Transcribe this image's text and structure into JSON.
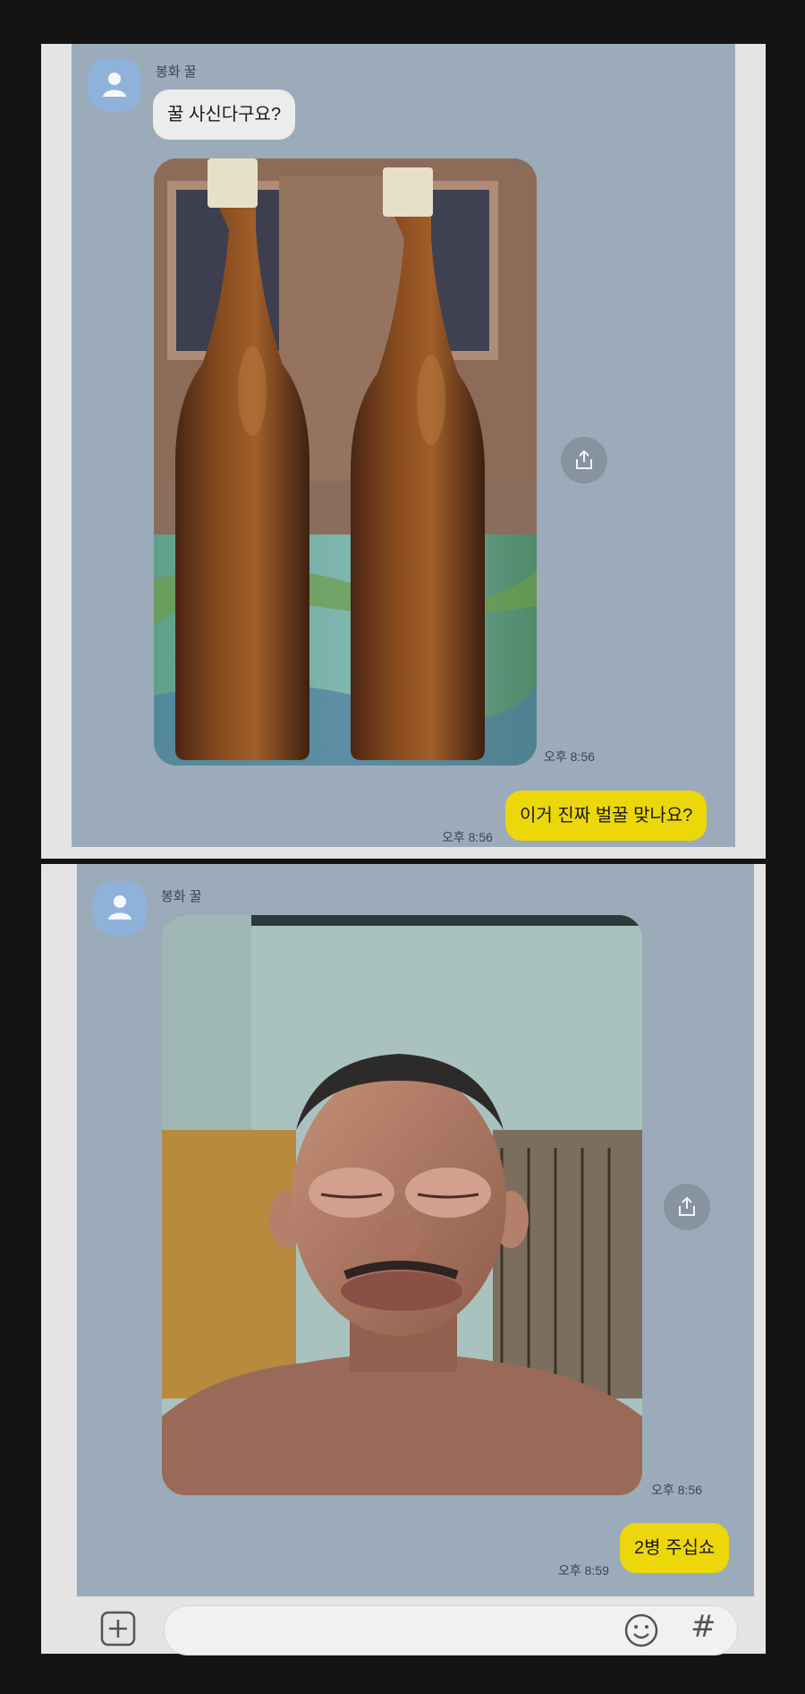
{
  "screenshot1": {
    "sender": "봉화 꿀",
    "incoming_message": "꿀 사신다구요?",
    "photo_time": "오후 8:56",
    "outgoing_message": "이거 진짜 벌꿀 맞나요?",
    "outgoing_time": "오후 8:56"
  },
  "screenshot2": {
    "sender": "봉화 꿀",
    "photo_time": "오후 8:56",
    "outgoing_message": "2병 주십쇼",
    "outgoing_time": "오후 8:59"
  },
  "input_bar": {
    "add_icon": "plus-square-icon",
    "emoji_icon": "smiley-icon",
    "hash_icon": "hashtag-icon",
    "hash_symbol": "#"
  },
  "colors": {
    "chat_background": "#9babba",
    "incoming_bubble": "#ececec",
    "outgoing_bubble": "#ecd70a",
    "avatar": "#8fb2da"
  }
}
